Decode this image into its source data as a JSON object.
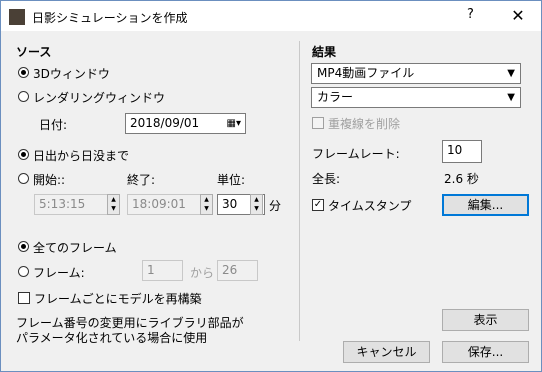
{
  "window": {
    "title": "日影シミュレーションを作成",
    "help": "?",
    "close": "✕"
  },
  "source": {
    "heading": "ソース",
    "radio_3d": "3Dウィンドウ",
    "radio_render": "レンダリングウィンドウ",
    "date_label": "日付:",
    "date_value": "2018/09/01",
    "radio_sunrise": "日出から日没まで",
    "radio_start": "開始::",
    "end_label": "終了:",
    "unit_label": "単位:",
    "start_value": "5:13:15",
    "end_value": "18:09:01",
    "unit_value": "30",
    "unit_suffix": "分",
    "radio_all_frames": "全てのフレーム",
    "radio_frame": "フレーム:",
    "frame_from": "1",
    "from_label": "から",
    "frame_to": "26",
    "rebuild_label": "フレームごとにモデルを再構築",
    "note_line1": "フレーム番号の変更用にライブラリ部品が",
    "note_line2": "パラメータ化されている場合に使用"
  },
  "result": {
    "heading": "結果",
    "format_value": "MP4動画ファイル",
    "color_value": "カラー",
    "remove_dup_label": "重複線を削除",
    "frame_rate_label": "フレームレート:",
    "frame_rate_value": "10",
    "length_label": "全長:",
    "length_value": "2.6 秒",
    "timestamp_label": "タイムスタンプ",
    "edit_button": "編集...",
    "show_button": "表示"
  },
  "footer": {
    "cancel_button": "キャンセル",
    "save_button": "保存..."
  }
}
